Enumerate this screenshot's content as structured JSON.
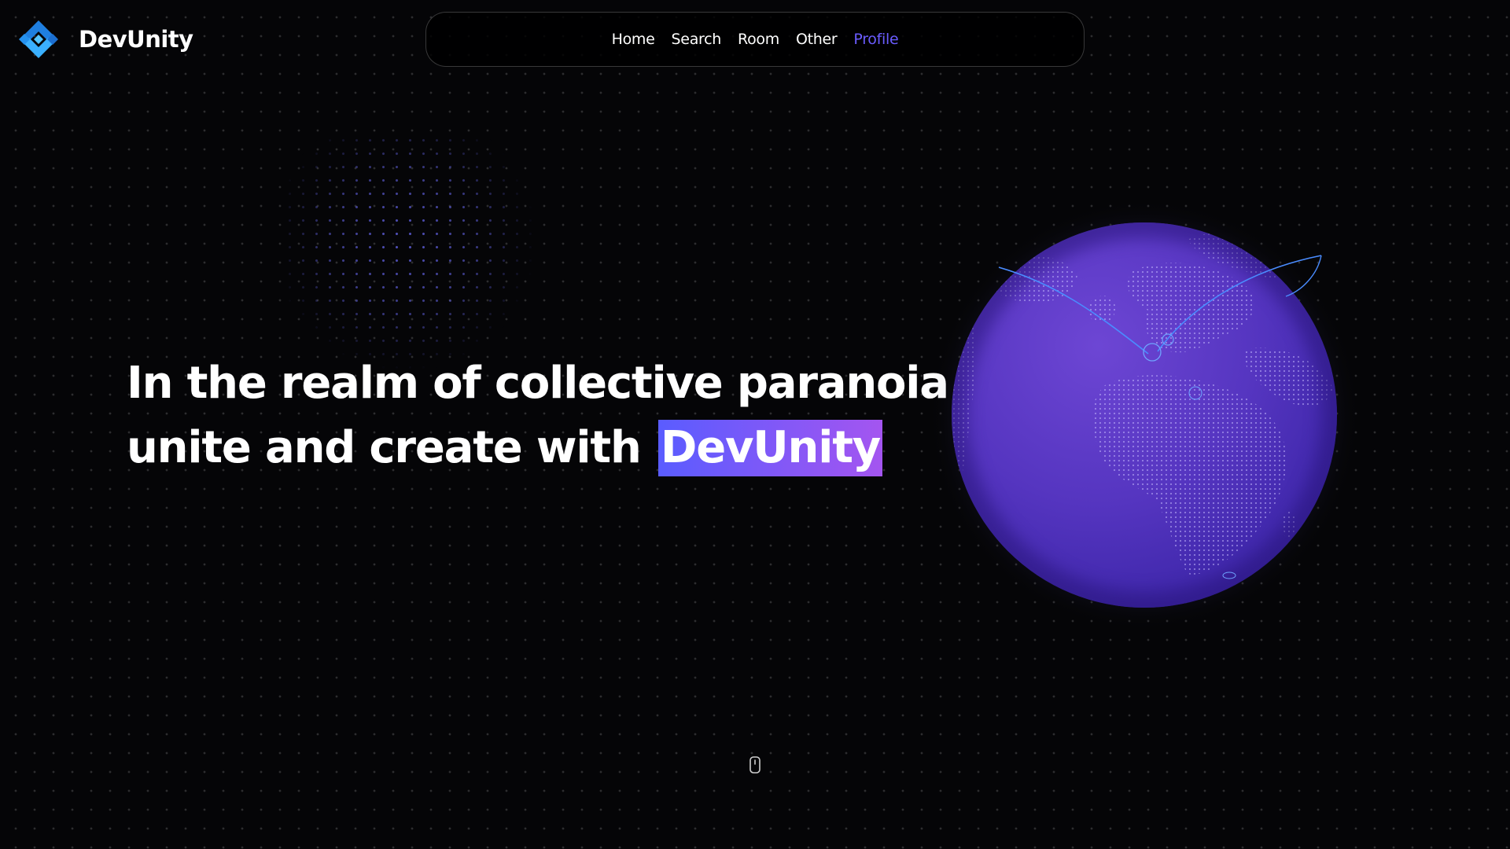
{
  "brand": {
    "name": "DevUnity",
    "logo_icon": "diamond-code-icon",
    "accent": "#2f9bff"
  },
  "nav": {
    "items": [
      {
        "label": "Home"
      },
      {
        "label": "Search"
      },
      {
        "label": "Room"
      },
      {
        "label": "Other"
      },
      {
        "label": "Profile"
      }
    ],
    "active": "Profile",
    "active_color": "#6a5cff"
  },
  "hero": {
    "line1": "In the realm of collective paranoia",
    "line2_prefix": "unite and create with",
    "highlight": "DevUnity",
    "highlight_gradient": [
      "#5a5cff",
      "#a455f0"
    ]
  },
  "globe": {
    "icon": "globe-icon",
    "color": "#5b3cc4"
  },
  "scroll_indicator": {
    "icon": "mouse-scroll-icon"
  },
  "colors": {
    "background": "#050507",
    "text": "#ffffff"
  }
}
